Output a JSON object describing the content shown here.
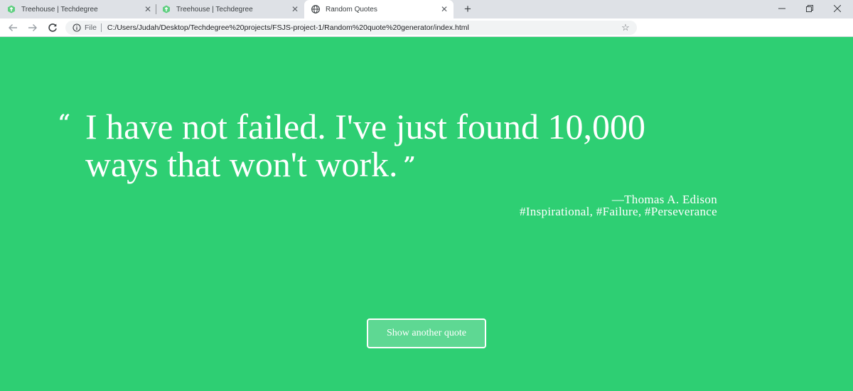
{
  "browser": {
    "tabs": [
      {
        "title": "Treehouse | Techdegree",
        "active": false
      },
      {
        "title": "Treehouse | Techdegree",
        "active": false
      },
      {
        "title": "Random Quotes",
        "active": true
      }
    ],
    "address": {
      "scheme_label": "File",
      "url": "C:/Users/Judah/Desktop/Techdegree%20projects/FSJS-project-1/Random%20quote%20generator/index.html"
    }
  },
  "quote": {
    "open_mark": "“",
    "text": "I have not failed. I've just found 10,000 ways that won't work.",
    "close_mark": "”",
    "source": "—Thomas A. Edison",
    "tags": "#Inspirational, #Failure, #Perseverance"
  },
  "button": {
    "label": "Show another quote"
  },
  "colors": {
    "page_background": "#2ecf73",
    "button_background": "#5ed893",
    "text": "#ffffff"
  }
}
